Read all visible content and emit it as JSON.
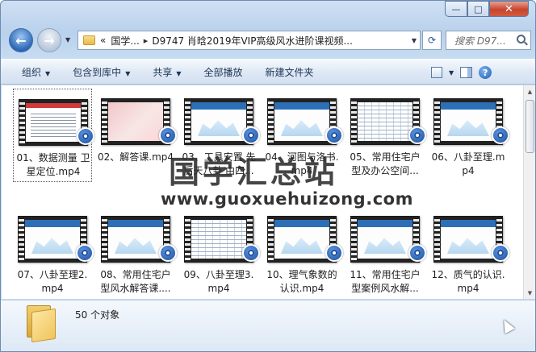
{
  "window": {
    "controls": {
      "minimize": "—",
      "maximize": "□",
      "close": "✕"
    }
  },
  "nav": {
    "back_icon": "arrow-left-icon",
    "forward_icon": "arrow-right-icon",
    "address": {
      "overflow": "«",
      "segment1": "国学...",
      "separator": "▸",
      "segment2": "D9747 肖晗2019年VIP高级风水进阶课视频..."
    },
    "refresh_glyph": "⟳",
    "search_placeholder": "搜索 D97..."
  },
  "toolbar": {
    "organize": "组织",
    "include_library": "包含到库中",
    "share": "共享",
    "play_all": "全部播放",
    "new_folder": "新建文件夹"
  },
  "files": [
    {
      "name": "01、数据测量 卫星定位.mp4",
      "thumb": "doc"
    },
    {
      "name": "02、解答课.mp4",
      "thumb": "pink"
    },
    {
      "name": "03、工具安置 先后天八卦 由四...",
      "thumb": "plan"
    },
    {
      "name": "04、河图与洛书.mp4",
      "thumb": "plan"
    },
    {
      "name": "05、常用住宅户型及办公空间...",
      "thumb": "sheet"
    },
    {
      "name": "06、八卦至理.mp4",
      "thumb": "plan"
    },
    {
      "name": "07、八卦至理2.mp4",
      "thumb": "plan"
    },
    {
      "name": "08、常用住宅户型风水解答课....",
      "thumb": "plan"
    },
    {
      "name": "09、八卦至理3.mp4",
      "thumb": "sheet"
    },
    {
      "name": "10、理气象数的认识.mp4",
      "thumb": "plan"
    },
    {
      "name": "11、常用住宅户型案例风水解...",
      "thumb": "plan"
    },
    {
      "name": "12、质气的认识.mp4",
      "thumb": "plan"
    }
  ],
  "status": {
    "count": "50 个对象"
  },
  "watermark": {
    "cn": "国学汇总站",
    "url": "www.guoxuehuizong.com"
  }
}
